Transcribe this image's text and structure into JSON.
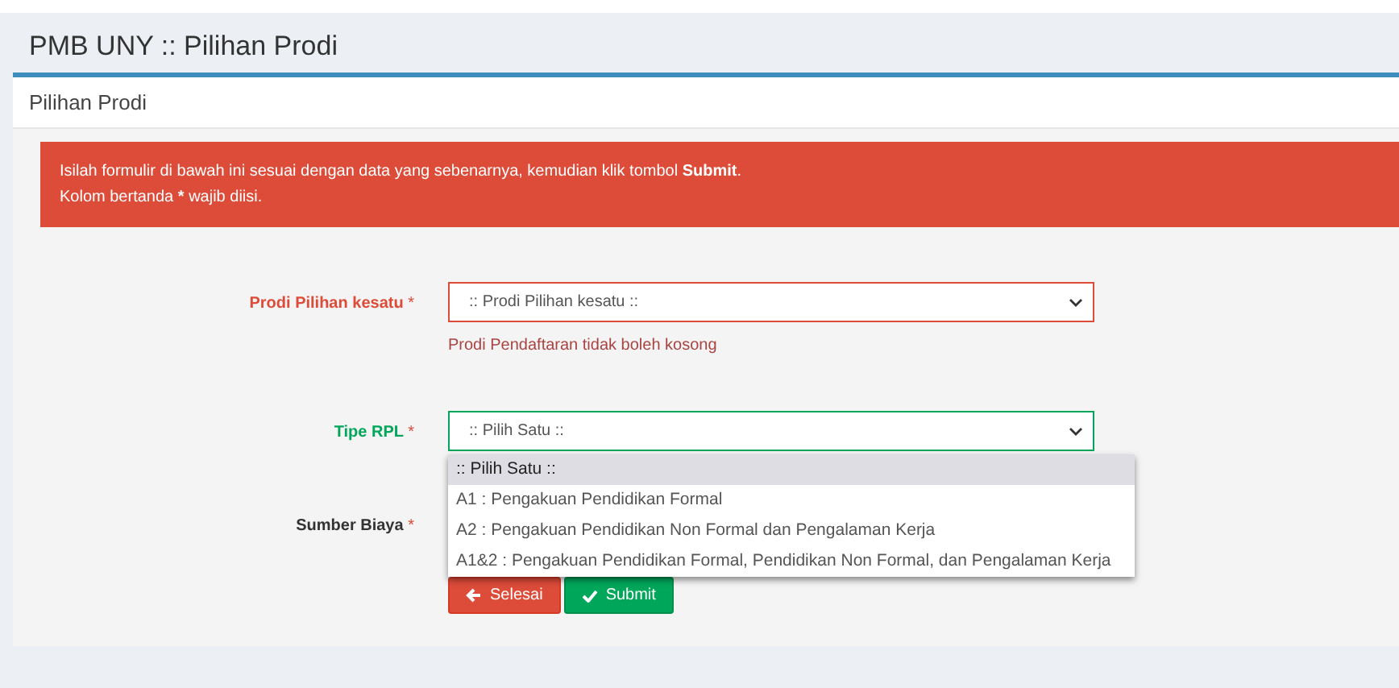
{
  "page_title": "PMB UNY :: Pilihan Prodi",
  "box": {
    "title": "Pilihan Prodi"
  },
  "alert": {
    "lines": [
      [
        {
          "text": "Isilah formulir di bawah ini sesuai dengan data yang sebenarnya, kemudian klik tombol ",
          "bold": false
        },
        {
          "text": "Submit",
          "bold": true
        },
        {
          "text": ".",
          "bold": false
        }
      ],
      [
        {
          "text": "Kolom bertanda ",
          "bold": false
        },
        {
          "text": "*",
          "bold": true
        },
        {
          "text": " wajib diisi.",
          "bold": false
        }
      ]
    ]
  },
  "fields": [
    {
      "label": "Prodi Pilihan kesatu",
      "required_mark": "*",
      "kind": "error",
      "value": ":: Prodi Pilihan kesatu ::",
      "help": "Prodi Pendaftaran tidak boleh kosong"
    },
    {
      "label": "Tipe RPL",
      "required_mark": "*",
      "kind": "success",
      "value": ":: Pilih Satu ::",
      "expanded": true,
      "options": [
        {
          "label": ":: Pilih Satu ::",
          "selected": true
        },
        {
          "label": "A1 : Pengakuan Pendidikan Formal",
          "selected": false
        },
        {
          "label": "A2 : Pengakuan Pendidikan Non Formal dan Pengalaman Kerja",
          "selected": false
        },
        {
          "label": "A1&2 : Pengakuan Pendidikan Formal, Pendidikan Non Formal, dan Pengalaman Kerja",
          "selected": false
        }
      ]
    },
    {
      "label": "Sumber Biaya",
      "required_mark": "*",
      "kind": "plain"
    }
  ],
  "buttons": [
    {
      "kind": "back",
      "label": "Selesai"
    },
    {
      "kind": "submit",
      "label": "Submit"
    }
  ]
}
